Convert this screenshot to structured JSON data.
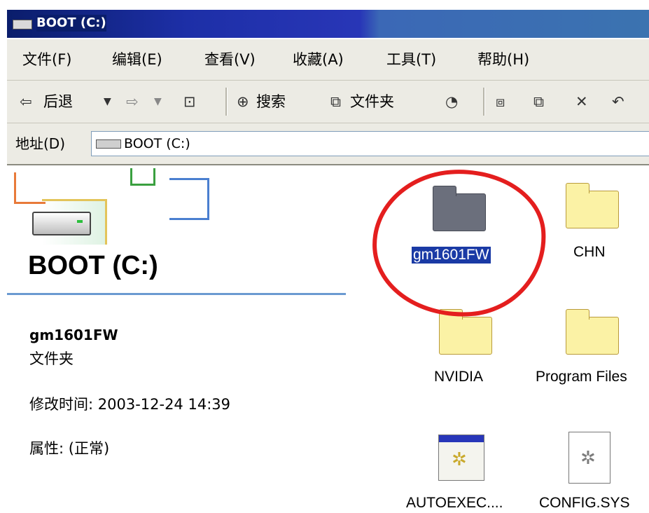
{
  "window": {
    "title": "BOOT (C:)"
  },
  "menu": [
    "文件(F)",
    "编辑(E)",
    "查看(V)",
    "收藏(A)",
    "工具(T)",
    "帮助(H)"
  ],
  "toolbar": {
    "back_label": "后退",
    "back_icon": "back-arrow-icon",
    "search_label": "搜索",
    "folders_label": "文件夹"
  },
  "address": {
    "label": "地址(D)",
    "value": "BOOT (C:)"
  },
  "left_pane": {
    "drive_title": "BOOT (C:)",
    "selected_name": "gm1601FW",
    "selected_type": "文件夹",
    "modified": "修改时间: 2003-12-24 14:39",
    "attributes": "属性: (正常)"
  },
  "files": [
    {
      "name": "gm1601FW",
      "kind": "folder",
      "selected": true
    },
    {
      "name": "CHN",
      "kind": "folder"
    },
    {
      "name": "NVIDIA",
      "kind": "folder"
    },
    {
      "name": "Program Files",
      "kind": "folder"
    },
    {
      "name": "AUTOEXEC....",
      "kind": "batch-file"
    },
    {
      "name": "CONFIG.SYS",
      "kind": "system-file"
    }
  ],
  "colors": {
    "title_bar": "#1d2fa7",
    "selection": "#1a3aa5",
    "annotation_circle": "#e41e1e"
  }
}
